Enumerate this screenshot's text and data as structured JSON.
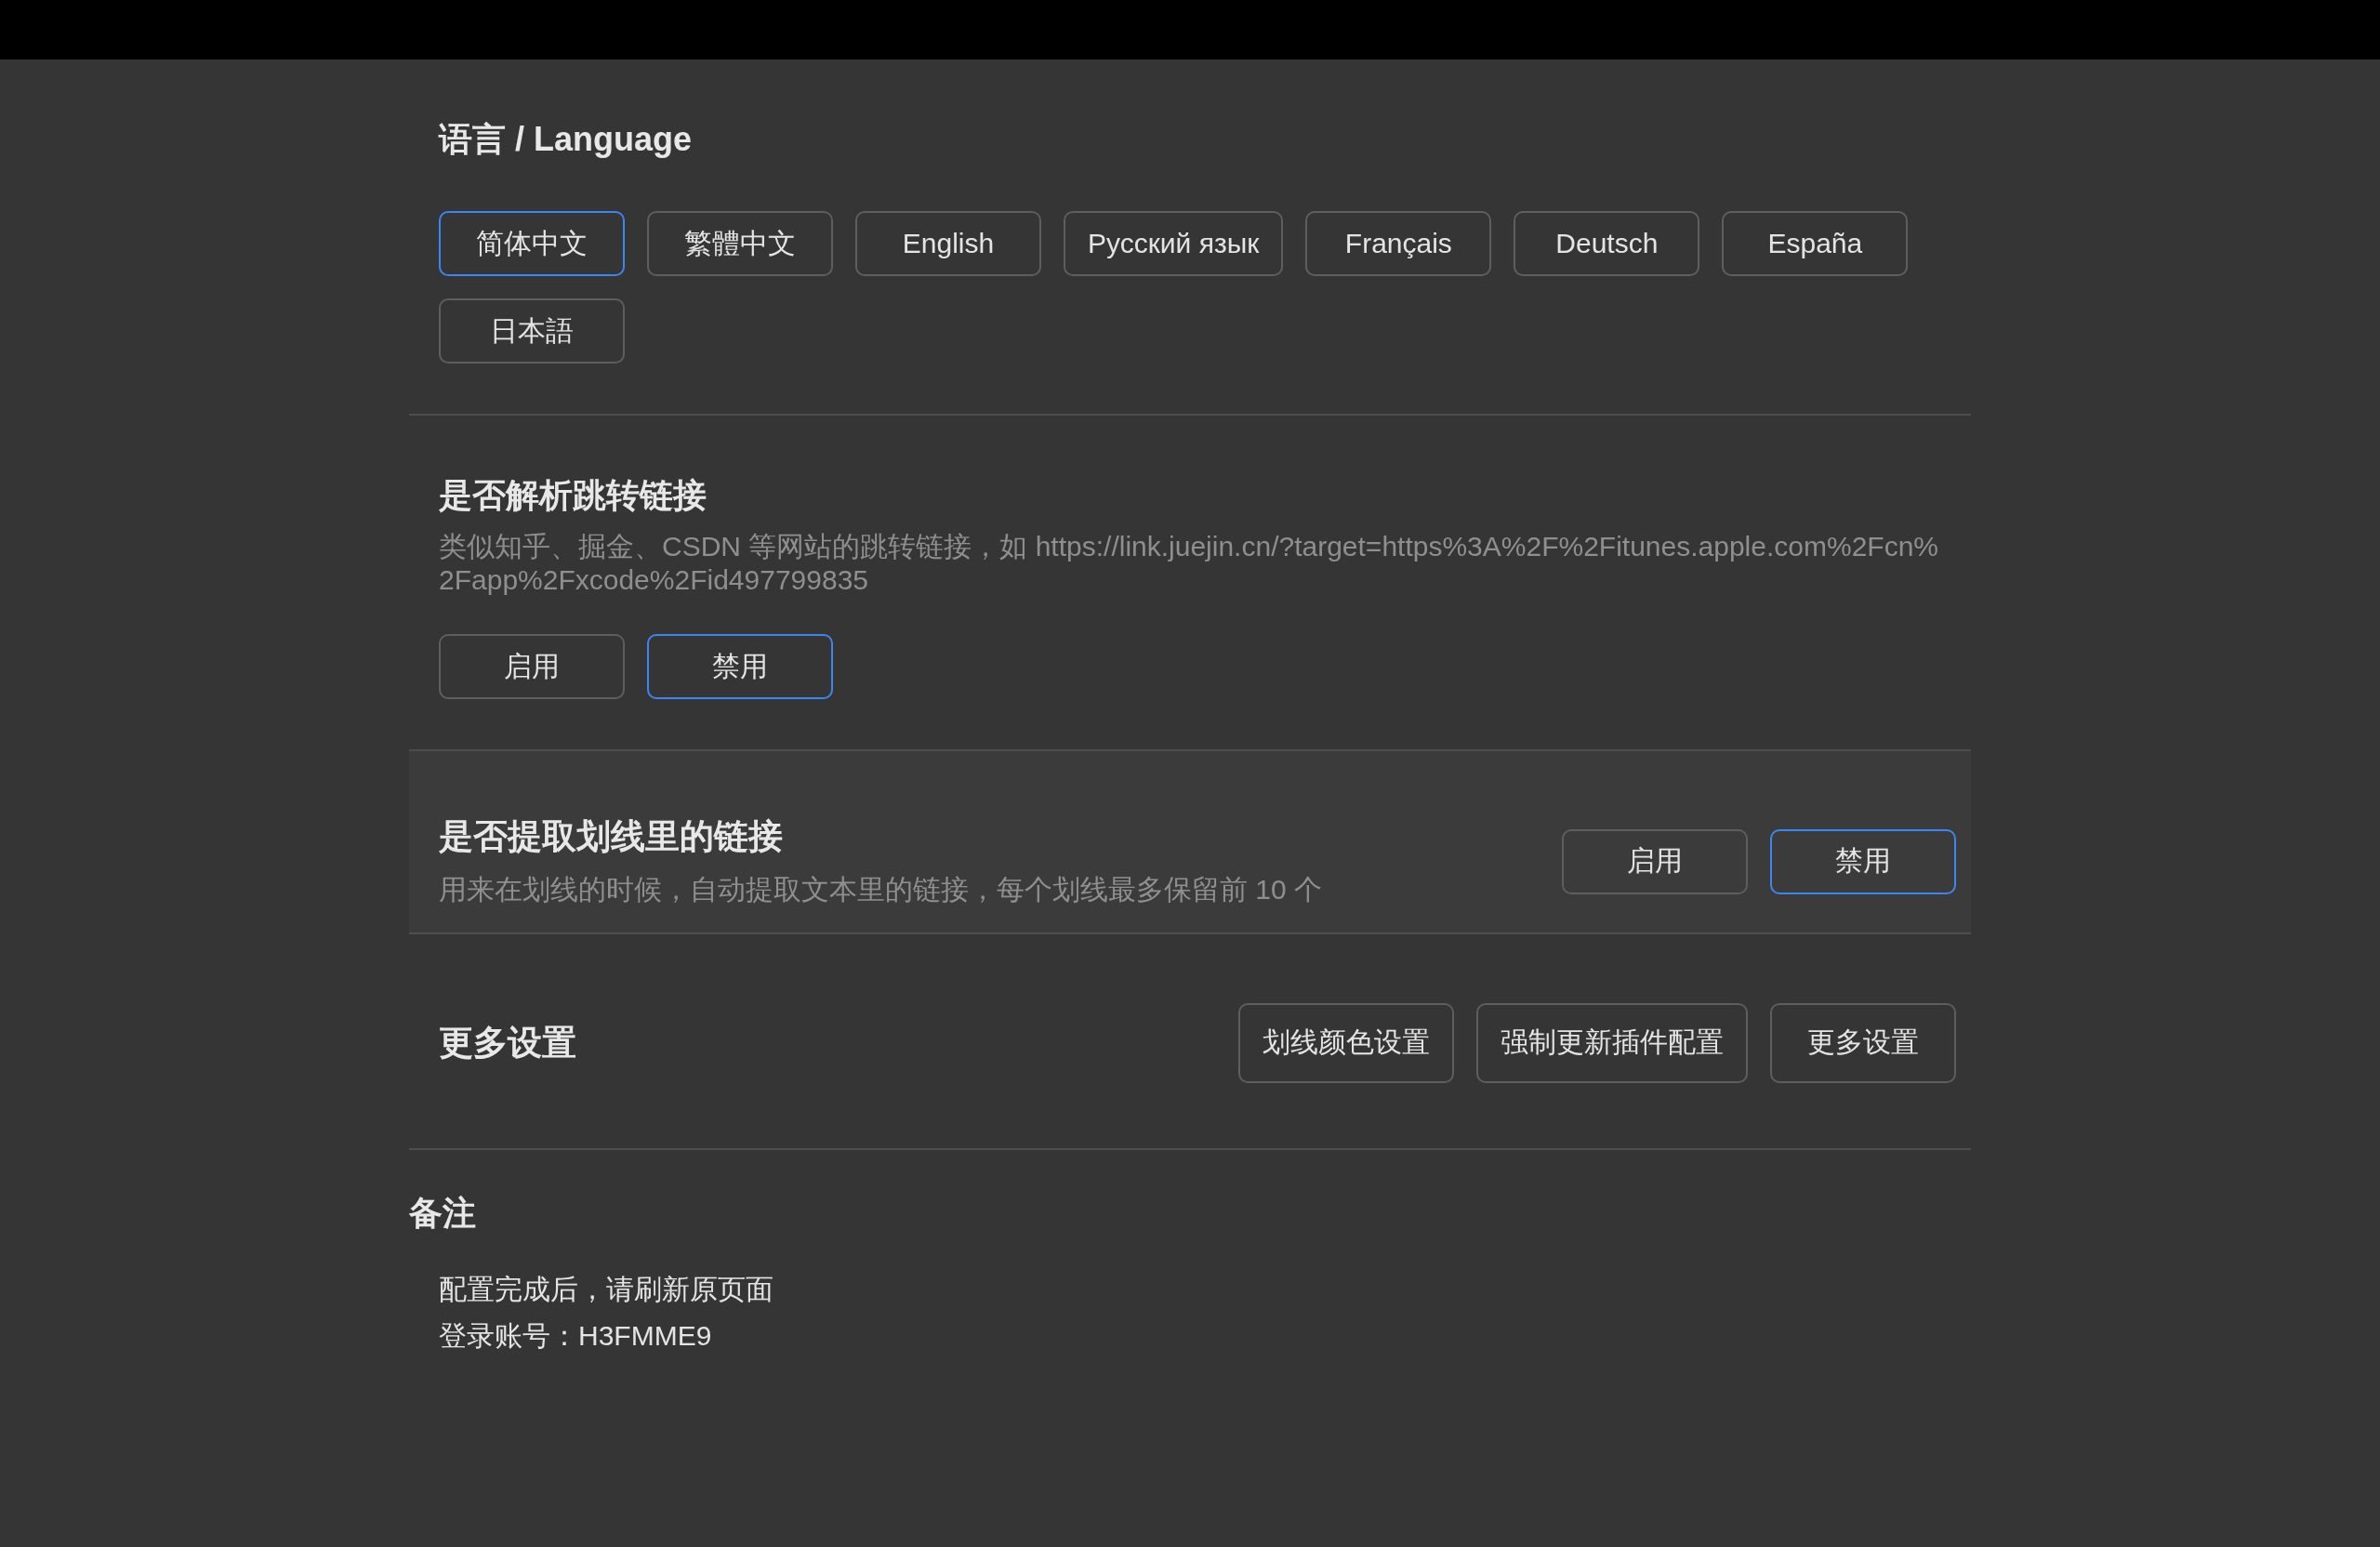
{
  "language": {
    "title": "语言 / Language",
    "options": [
      {
        "label": "简体中文",
        "selected": true
      },
      {
        "label": "繁體中文",
        "selected": false
      },
      {
        "label": "English",
        "selected": false
      },
      {
        "label": "Русский язык",
        "selected": false
      },
      {
        "label": "Français",
        "selected": false
      },
      {
        "label": "Deutsch",
        "selected": false
      },
      {
        "label": "España",
        "selected": false
      },
      {
        "label": "日本語",
        "selected": false
      }
    ]
  },
  "parse_redirect": {
    "title": "是否解析跳转链接",
    "description": "类似知乎、掘金、CSDN 等网站的跳转链接，如 https://link.juejin.cn/?target=https%3A%2F%2Fitunes.apple.com%2Fcn%2Fapp%2Fxcode%2Fid497799835",
    "options": [
      {
        "label": "启用",
        "selected": false
      },
      {
        "label": "禁用",
        "selected": true
      }
    ]
  },
  "extract_links": {
    "title": "是否提取划线里的链接",
    "description": "用来在划线的时候，自动提取文本里的链接，每个划线最多保留前 10 个",
    "options": [
      {
        "label": "启用",
        "selected": false
      },
      {
        "label": "禁用",
        "selected": true
      }
    ]
  },
  "more_settings": {
    "title": "更多设置",
    "buttons": [
      "划线颜色设置",
      "强制更新插件配置",
      "更多设置"
    ]
  },
  "notes": {
    "title": "备注",
    "lines": [
      "配置完成后，请刷新原页面",
      "登录账号：H3FMME9"
    ]
  }
}
